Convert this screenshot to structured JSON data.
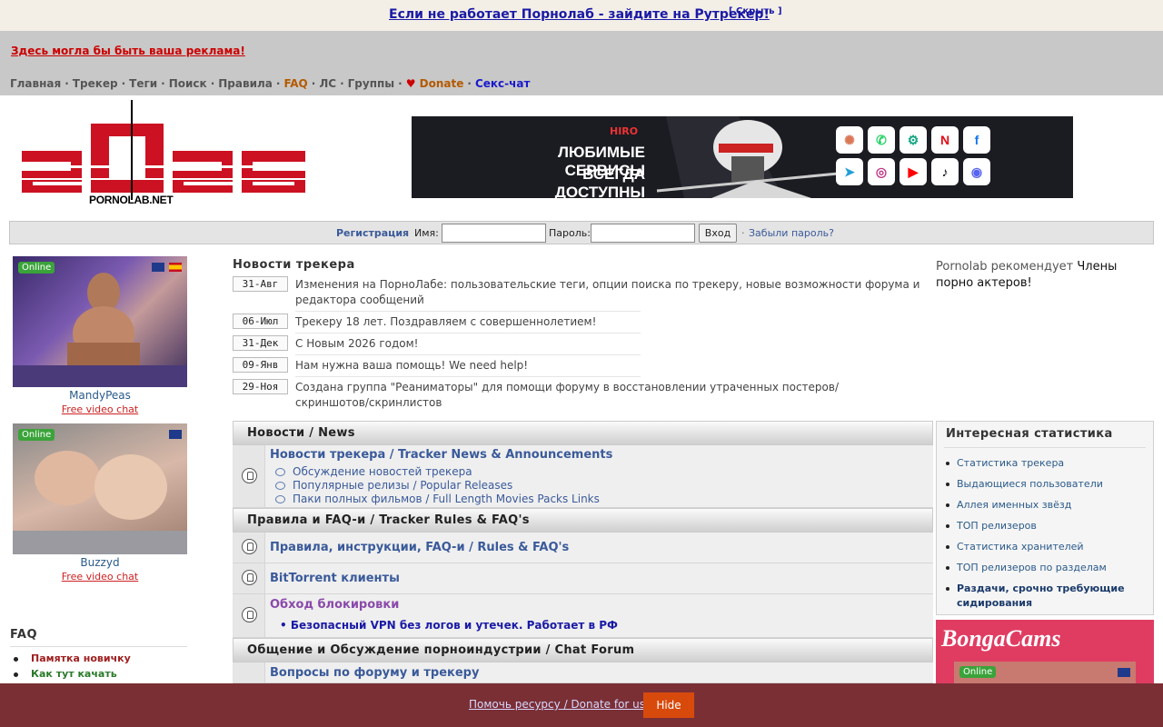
{
  "notice": {
    "text": "Если не работает Порнолаб - зайдите на Рутрекер!",
    "hide": "[ Скрыть ]"
  },
  "header": {
    "ad_text": "Здесь могла бы быть ваша реклама!",
    "nav": [
      "Главная",
      "Трекер",
      "Теги",
      "Поиск",
      "Правила",
      "FAQ",
      "ЛС",
      "Группы",
      "Donate",
      "Секс-чат"
    ],
    "sep": "·"
  },
  "logo": {
    "year": "2026",
    "caption": "PORNOLAB.NET",
    "color": "#cc1122"
  },
  "banner": {
    "brand": "HIRO",
    "line1": "ЛЮБИМЫЕ СЕРВИСЫ",
    "line2": "ВСЕГДА ДОСТУПНЫ",
    "icons": [
      "claude-icon",
      "whatsapp-icon",
      "chatgpt-icon",
      "netflix-icon",
      "facebook-icon",
      "telegram-icon",
      "instagram-icon",
      "youtube-icon",
      "tiktok-icon",
      "discord-icon"
    ]
  },
  "login": {
    "register": "Регистрация",
    "name_label": "Имя:",
    "password_label": "Пароль:",
    "submit": "Вход",
    "forgot": "Забыли пароль?",
    "sep": "·"
  },
  "cams": [
    {
      "status": "Online",
      "name": "MandyPeas",
      "link": "Free video chat"
    },
    {
      "status": "Online",
      "name": "Buzzyd",
      "link": "Free video chat"
    }
  ],
  "faq": {
    "title": "FAQ",
    "items": [
      {
        "label": "Памятка новичку",
        "color": "#a02020"
      },
      {
        "label": "Как тут качать",
        "color": "#2a7a2a"
      }
    ]
  },
  "news": {
    "title": "Новости трекера",
    "items": [
      {
        "date": "31-Авг",
        "text": "Изменения на ПорноЛабе: пользовательские теги, опции поиска по трекеру, новые возможности форума и редактора сообщений"
      },
      {
        "date": "06-Июл",
        "text": "Трекеру 18 лет. Поздравляем с совершеннолетием!"
      },
      {
        "date": "31-Дек",
        "text": "С Новым 2026 годом!"
      },
      {
        "date": "09-Янв",
        "text": "Нам нужна ваша помощь! We need help!"
      },
      {
        "date": "29-Ноя",
        "text": "Создана группа \"Реаниматоры\" для помощи форуму в восстановлении утраченных постеров/скриншотов/скринлистов"
      }
    ]
  },
  "recommend": {
    "prefix": "Pornolab рекомендует",
    "link": "Члены порно актеров!"
  },
  "forum": {
    "cat1": "Новости / News",
    "f1_title": "Новости трекера / Tracker News & Announcements",
    "f1_subs": [
      "Обсуждение новостей трекера",
      "Популярные релизы / Popular Releases",
      "Паки полных фильмов / Full Length Movies Packs Links"
    ],
    "cat2": "Правила и FAQ-и / Tracker Rules & FAQ's",
    "f2_title": "Правила, инструкции, FAQ-и / Rules & FAQ's",
    "f3_title": "BitTorrent клиенты",
    "f4_title": "Обход блокировки",
    "f4_sub": "• Безопасный VPN без логов и утечек. Работает в РФ",
    "cat3": "Общение и Обсуждение порноиндустрии / Chat Forum",
    "f5_title": "Вопросы по форуму и трекеру"
  },
  "stats": {
    "title": "Интересная статистика",
    "items": [
      "Статистика трекера",
      "Выдающиеся пользователи",
      "Аллея именных звёзд",
      "ТОП релизеров",
      "Статистика хранителей",
      "ТОП релизеров по разделам",
      "Раздачи, срочно требующие сидирования"
    ]
  },
  "bonga": {
    "logo": "BongaCams",
    "status": "Online"
  },
  "bottom": {
    "link": "Помочь ресурсу / Donate for us",
    "hide": "Hide"
  }
}
